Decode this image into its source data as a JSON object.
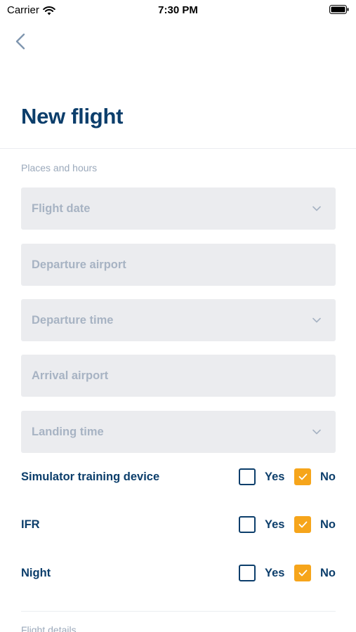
{
  "status_bar": {
    "carrier": "Carrier",
    "time": "7:30 PM"
  },
  "nav": {
    "back_icon": "chevron-left-icon"
  },
  "page": {
    "title": "New flight"
  },
  "sections": {
    "places": "Places and hours",
    "details": "Flight details"
  },
  "fields": [
    {
      "placeholder": "Flight date",
      "has_dropdown": true
    },
    {
      "placeholder": "Departure airport",
      "has_dropdown": false
    },
    {
      "placeholder": "Departure time",
      "has_dropdown": true
    },
    {
      "placeholder": "Arrival airport",
      "has_dropdown": false
    },
    {
      "placeholder": "Landing time",
      "has_dropdown": true
    }
  ],
  "toggles": [
    {
      "label": "Simulator training device",
      "yes": "Yes",
      "no": "No",
      "selected": "No"
    },
    {
      "label": "IFR",
      "yes": "Yes",
      "no": "No",
      "selected": "No"
    },
    {
      "label": "Night",
      "yes": "Yes",
      "no": "No",
      "selected": "No"
    }
  ],
  "colors": {
    "primary": "#0c3e6b",
    "accent": "#f6a51b",
    "field_bg": "#ebecef",
    "placeholder": "#a7b3c3",
    "muted_label": "#9ba9bb"
  }
}
